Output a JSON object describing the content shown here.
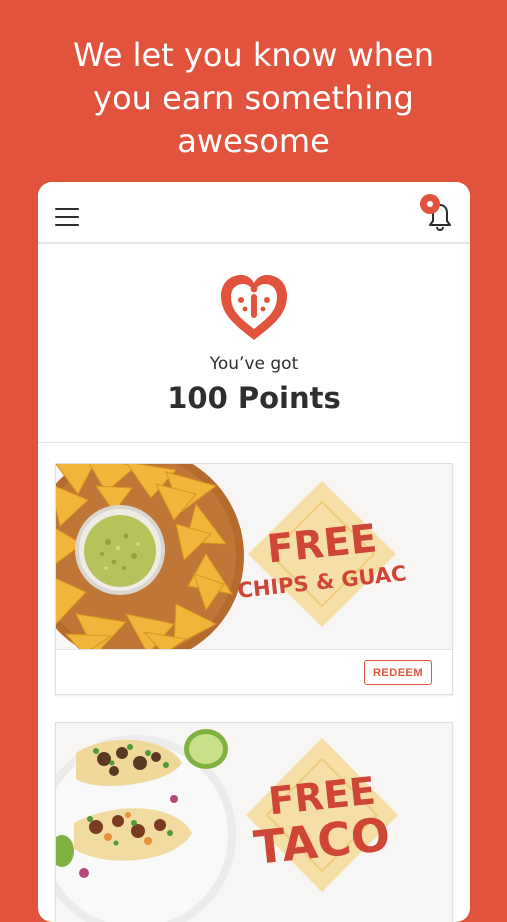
{
  "colors": {
    "accent": "#e2533d",
    "text_dark": "#2e2e2e",
    "promo_diamond": "#f6dfa6"
  },
  "headline": {
    "line1": "We let you know when",
    "line2": "you earn something",
    "line3": "awesome"
  },
  "appbar": {
    "menu_icon": "hamburger-icon",
    "bell_icon": "bell-icon"
  },
  "rewards": {
    "logo_icon": "heart-logo-icon",
    "label": "You’ve got",
    "points": "100 Points"
  },
  "offers": [
    {
      "title_line1": "FREE",
      "title_line2": "CHIPS & GUAC",
      "button": "REDEEM"
    },
    {
      "title_line1": "FREE",
      "title_line2": "TACO"
    }
  ]
}
